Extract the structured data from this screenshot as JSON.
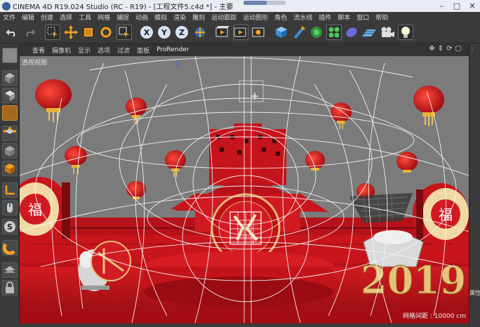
{
  "window": {
    "title": "CINEMA 4D R19.024 Studio (RC - R19) - [工程文件5.c4d *] - 主要",
    "progress": 0.55,
    "controls": [
      "minimize-icon",
      "maximize-icon",
      "close-icon"
    ]
  },
  "menubar": {
    "items": [
      "文件",
      "编辑",
      "创建",
      "选择",
      "工具",
      "网格",
      "捕捉",
      "动画",
      "模拟",
      "渲染",
      "雕刻",
      "运动跟踪",
      "运动图形",
      "角色",
      "流水线",
      "插件",
      "脚本",
      "窗口",
      "帮助"
    ]
  },
  "toolbar": {
    "axis_x": "X",
    "axis_y": "Y",
    "axis_z": "Z",
    "icons": [
      "undo-icon",
      "redo-icon",
      "live-select-icon",
      "move-icon",
      "scale-icon",
      "rotate-icon",
      "recent-tool-icon",
      "x-axis-lock-icon",
      "y-axis-lock-icon",
      "z-axis-lock-icon",
      "coordinate-system-icon",
      "render-view-icon",
      "render-picture-viewer-icon",
      "render-settings-icon",
      "cube-icon",
      "pen-icon",
      "subdivision-icon",
      "cloner-icon",
      "deformer-icon",
      "floor-icon",
      "camera-icon",
      "light-icon"
    ]
  },
  "left_tools": [
    "make-editable-icon",
    "model-mode-icon",
    "texture-mode-icon",
    "workplane-icon",
    "points-mode-icon",
    "edges-mode-icon",
    "polygons-mode-icon",
    "axis-icon",
    "tweak-icon",
    "snap-icon",
    "magnet-icon",
    "layer-icon",
    "lock-icon"
  ],
  "viewport_menu": {
    "items": [
      "查看",
      "摄像机",
      "显示",
      "选项",
      "过滤",
      "面板",
      "ProRender"
    ],
    "nav_icons": [
      "move-view-icon",
      "zoom-view-icon",
      "rotate-view-icon",
      "maximize-view-icon"
    ]
  },
  "viewport": {
    "label": "透视视图",
    "grid_info": "网格间距 : 10000 cm",
    "scene_text": "2019"
  },
  "right_panel": {
    "side_label": "属性"
  },
  "colors": {
    "viewport_bg": "#7b7b7b",
    "scene_red": "#c8141b",
    "gold": "#e8c27a"
  }
}
